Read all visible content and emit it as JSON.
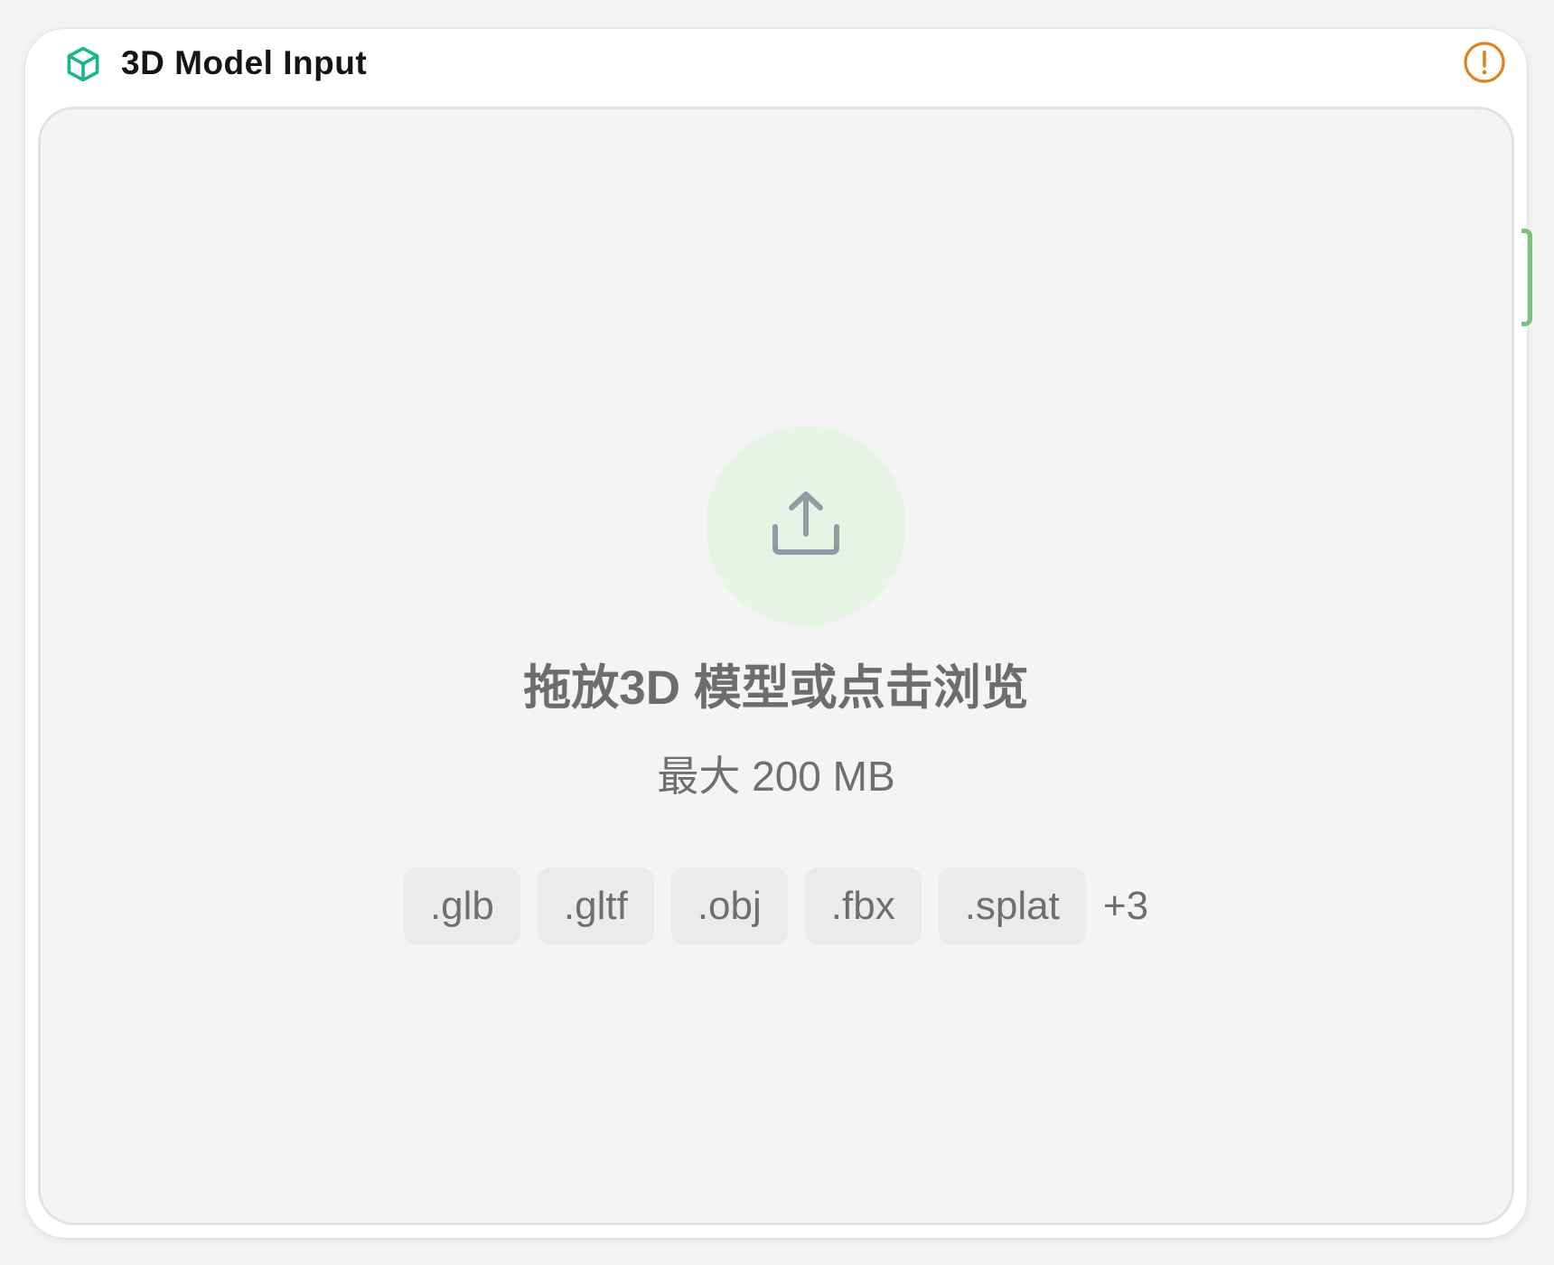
{
  "node": {
    "title": "3D Model Input",
    "icon": "cube-icon",
    "status_icon": "warning-circle-icon"
  },
  "drop_zone": {
    "icon": "upload-icon",
    "title": "拖放3D 模型或点击浏览",
    "subtitle": "最大 200 MB",
    "formats": [
      ".glb",
      ".gltf",
      ".obj",
      ".fbx",
      ".splat"
    ],
    "more_label": "+3"
  },
  "colors": {
    "accent_green": "#18b88a",
    "warning_orange": "#dd8420",
    "handle_green": "#7cbf7e",
    "upload_bg": "#e6f3e5"
  }
}
